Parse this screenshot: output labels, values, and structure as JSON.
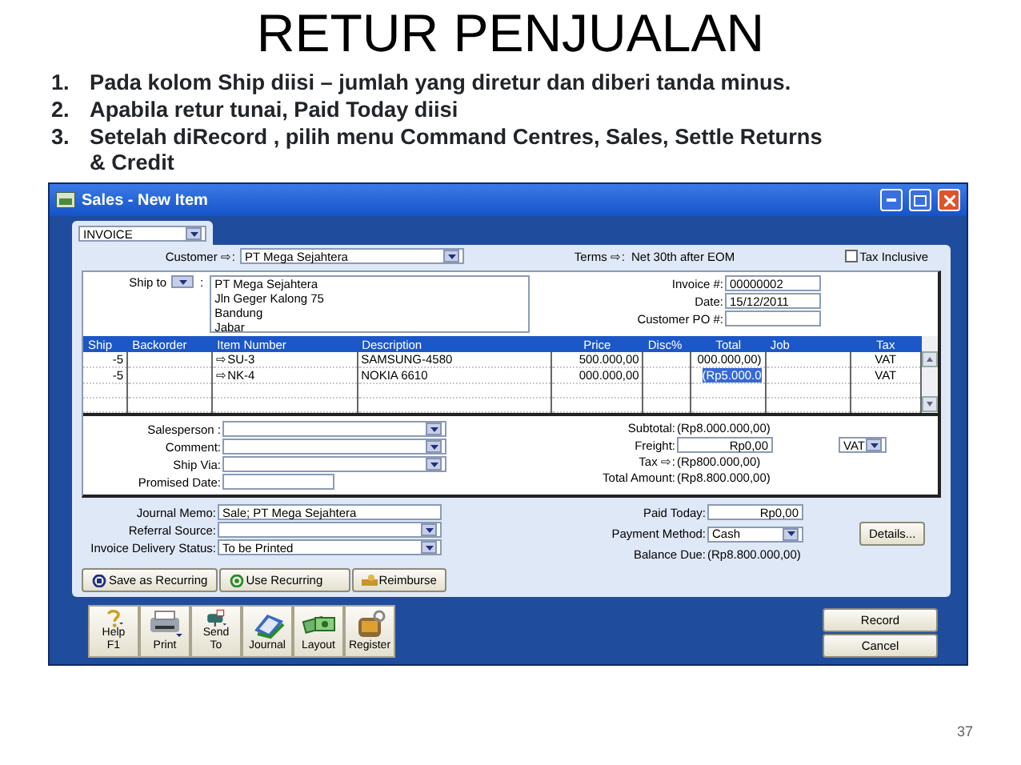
{
  "slide": {
    "title": "RETUR PENJUALAN",
    "steps": [
      {
        "number": "1.",
        "text": "Pada kolom Ship diisi – jumlah yang diretur dan diberi tanda minus."
      },
      {
        "number": "2.",
        "text": "Apabila retur tunai, Paid Today diisi"
      },
      {
        "number": "3.",
        "text": "Setelah diRecord , pilih menu Command Centres,  Sales, Settle Returns & Credit"
      }
    ],
    "page_number": "37"
  },
  "window": {
    "title": "Sales - New Item",
    "form_type": "INVOICE",
    "customer_label": "Customer ⇨:",
    "customer": "PT Mega Sejahtera",
    "terms_label": "Terms ⇨:",
    "terms": "Net 30th after EOM",
    "tax_inclusive": {
      "label": "Tax Inclusive",
      "checked": false
    },
    "ship_to_label": "Ship to",
    "ship_to_colon": ":",
    "ship_to": [
      "PT Mega Sejahtera",
      "Jln Geger Kalong 75",
      "Bandung",
      "Jabar"
    ],
    "header_fields": [
      {
        "label": "Invoice #:",
        "value": "00000002"
      },
      {
        "label": "Date:",
        "value": "15/12/2011"
      },
      {
        "label": "Customer PO #:"
      }
    ],
    "table": {
      "columns": [
        "Ship",
        "Backorder",
        "Item Number",
        "Description",
        "Price",
        "Disc%",
        "Total",
        "Job",
        "Tax"
      ],
      "rows": [
        {
          "ship": "-5",
          "item_number": "⇨SU-3",
          "description": "SAMSUNG-4580",
          "price": "500.000,00",
          "total": "000.000,00)",
          "tax": "VAT",
          "selected": false
        },
        {
          "ship": "-5",
          "item_number": "⇨NK-4",
          "description": "NOKIA 6610",
          "price": "000.000,00",
          "total": "(Rp5.000.0",
          "tax": "VAT",
          "selected": true
        }
      ]
    },
    "left_fields": [
      {
        "label": "Salesperson   :",
        "kind": "combo"
      },
      {
        "label": "Comment:",
        "kind": "combo"
      },
      {
        "label": "Ship Via:",
        "kind": "combo"
      },
      {
        "label": "Promised Date:",
        "kind": "text"
      }
    ],
    "totals": [
      {
        "label": "Subtotal:",
        "value": "(Rp8.000.000,00)",
        "kind": "plain"
      },
      {
        "label": "Freight:",
        "value": "Rp0,00",
        "kind": "field"
      },
      {
        "label": "Tax ⇨:",
        "value": "(Rp800.000,00)",
        "kind": "plain"
      },
      {
        "label": "Total Amount:",
        "value": "(Rp8.800.000,00)",
        "kind": "plain"
      }
    ],
    "freight_tax_code": "VAT",
    "memo_fields": [
      {
        "label": "Journal Memo:",
        "value": "Sale; PT Mega Sejahtera",
        "kind": "text"
      },
      {
        "label": "Referral Source:",
        "kind": "combo"
      },
      {
        "label": "Invoice Delivery Status:",
        "value": "To be Printed",
        "kind": "combo"
      }
    ],
    "payment_fields": [
      {
        "label": "Paid Today:",
        "value": "Rp0,00",
        "kind": "field"
      },
      {
        "label": "Payment Method:",
        "value": "Cash",
        "kind": "combo"
      },
      {
        "label": "Balance Due:",
        "value": "(Rp8.800.000,00)",
        "kind": "plain"
      }
    ],
    "details_button": "Details...",
    "action_buttons": [
      "Save as Recurring",
      "Use Recurring",
      "Reimburse"
    ],
    "toolbar": [
      "Help F1",
      "Print",
      "Send To",
      "Journal",
      "Layout",
      "Register"
    ],
    "record_button": "Record",
    "cancel_button": "Cancel"
  }
}
